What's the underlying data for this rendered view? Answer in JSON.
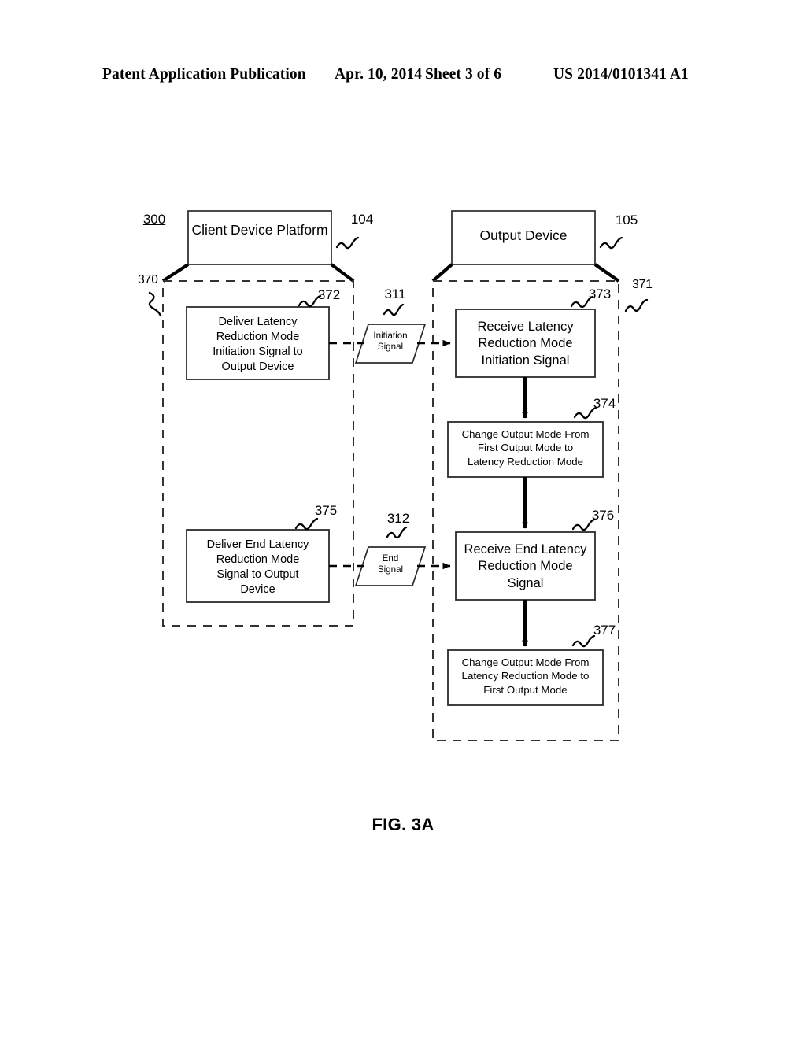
{
  "header": {
    "publication": "Patent Application Publication",
    "date": "Apr. 10, 2014",
    "sheet": "Sheet 3 of 6",
    "patent_number": "US 2014/0101341 A1"
  },
  "figure": {
    "caption": "FIG. 3A",
    "diagram_number": "300",
    "swimlanes": [
      {
        "title": "Client Device Platform",
        "header_ref": "104",
        "container_ref": "370"
      },
      {
        "title": "Output Device",
        "header_ref": "105",
        "container_ref": "371"
      }
    ],
    "process_boxes": [
      {
        "ref": "372",
        "text": "Deliver Latency\nReduction Mode\nInitiation Signal to\nOutput Device"
      },
      {
        "ref": "373",
        "text": "Receive Latency\nReduction Mode\nInitiation Signal"
      },
      {
        "ref": "374",
        "text": "Change Output Mode From\nFirst Output Mode to\nLatency Reduction Mode"
      },
      {
        "ref": "375",
        "text": "Deliver End Latency\nReduction Mode\nSignal to Output\nDevice"
      },
      {
        "ref": "376",
        "text": "Receive End Latency\nReduction Mode\nSignal"
      },
      {
        "ref": "377",
        "text": "Change Output Mode From\nLatency Reduction Mode to\nFirst Output Mode"
      }
    ],
    "signals": [
      {
        "ref": "311",
        "text": "Initiation\nSignal"
      },
      {
        "ref": "312",
        "text": "End\nSignal"
      }
    ]
  },
  "colors": {
    "ink": "#000000",
    "paper": "#ffffff",
    "box_stroke": "#1a1a1a"
  }
}
